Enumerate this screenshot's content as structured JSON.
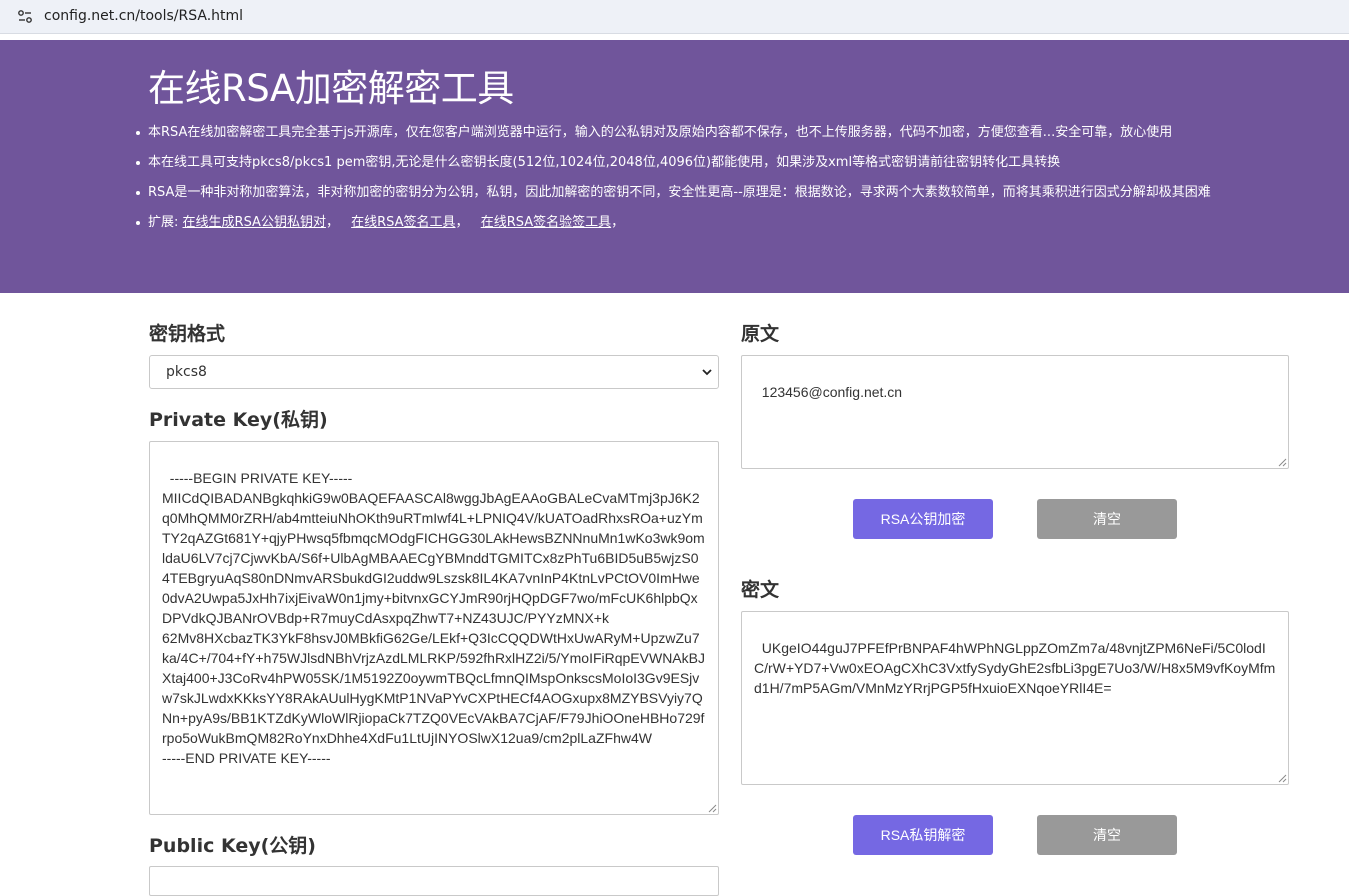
{
  "browser": {
    "url": "config.net.cn/tools/RSA.html"
  },
  "header": {
    "title": "在线RSA加密解密工具",
    "bullets": [
      "本RSA在线加密解密工具完全基于js开源库，仅在您客户端浏览器中运行，输入的公私钥对及原始内容都不保存，也不上传服务器，代码不加密，方便您查看...安全可靠，放心使用",
      "本在线工具可支持pkcs8/pkcs1 pem密钥,无论是什么密钥长度(512位,1024位,2048位,4096位)都能使用，如果涉及xml等格式密钥请前往密钥转化工具转换",
      "RSA是一种非对称加密算法，非对称加密的密钥分为公钥，私钥，因此加解密的密钥不同，安全性更高--原理是：根据数论，寻求两个大素数较简单，而将其乘积进行因式分解却极其困难"
    ],
    "extension_prefix": "扩展:",
    "extension_links": [
      "在线生成RSA公钥私钥对",
      "在线RSA签名工具",
      "在线RSA签名验签工具"
    ],
    "extension_separators": [
      "，",
      "，",
      "，"
    ]
  },
  "left": {
    "key_format_label": "密钥格式",
    "key_format_value": "pkcs8",
    "private_key_label": "Private Key(私钥)",
    "private_key_value": "-----BEGIN PRIVATE KEY-----\nMIICdQIBADANBgkqhkiG9w0BAQEFAASCAl8wggJbAgEAAoGBALeCvaMTmj3pJ6K2q0MhQMM0rZRH/ab4mtteiuNhOKth9uRTmIwf4L+LPNIQ4V/kUATOadRhxsROa+uzYmTY2qAZGt681Y+qjyPHwsq5fbmqcMOdgFICHGG30LAkHewsBZNNnuMn1wKo3wk9omldaU6LV7cj7CjwvKbA/S6f+UlbAgMBAAECgYBMnddTGMITCx8zPhTu6BID5uB5wjzS04TEBgryuAqS80nDNmvARSbukdGI2uddw9Lszsk8IL4KA7vnInP4KtnLvPCtOV0ImHwe0dvA2Uwpa5JxHh7ixjEivaW0n1jmy+bitvnxGCYJmR90rjHQpDGF7wo/mFcUK6hlpbQxDPVdkQJBANrOVBdp+R7muyCdAsxpqZhwT7+NZ43UJC/PYYzMNX+k\n62Mv8HXcbazTK3YkF8hsvJ0MBkfiG62Ge/LEkf+Q3IcCQQDWtHxUwARyM+UpzwZu7ka/4C+/704+fY+h75WJlsdNBhVrjzAzdLMLRKP/592fhRxlHZ2i/5/YmoIFiRqpEVWNAkBJXtaj400+J3CoRv4hPW05SK/1M5192Z0oywmTBQcLfmnQIMspOnkscsMoIoI3Gv9ESjvw7skJLwdxKKksYY8RAkAUulHygKMtP1NVaPYvCXPtHECf4AOGxupx8MZYBSVyiy7QNn+pyA9s/BB1KTZdKyWloWlRjiopaCk7TZQ0VEcVAkBA7CjAF/F79JhiOOneHBHo729frpo5oWukBmQM82RoYnxDhhe4XdFu1LtUjINYOSlwX12ua9/cm2plLaZFhw4W\n-----END PRIVATE KEY-----",
    "public_key_label": "Public Key(公钥)"
  },
  "right": {
    "plaintext_label": "原文",
    "plaintext_value": "123456@config.net.cn",
    "encrypt_button": "RSA公钥加密",
    "clear_button_1": "清空",
    "ciphertext_label": "密文",
    "ciphertext_value": "UKgeIO44guJ7PFEfPrBNPAF4hWPhNGLppZOmZm7a/48vnjtZPM6NeFi/5C0lodIC/rW+YD7+Vw0xEOAgCXhC3VxtfySydyGhE2sfbLi3pgE7Uo3/W/H8x5M9vfKoyMfmd1H/7mP5AGm/VMnMzYRrjPGP5fHxuioEXNqoeYRlI4E=",
    "decrypt_button": "RSA私钥解密",
    "clear_button_2": "清空"
  },
  "colors": {
    "banner": "#70559b",
    "primary_button": "#7568e3",
    "grey_button": "#999999"
  }
}
